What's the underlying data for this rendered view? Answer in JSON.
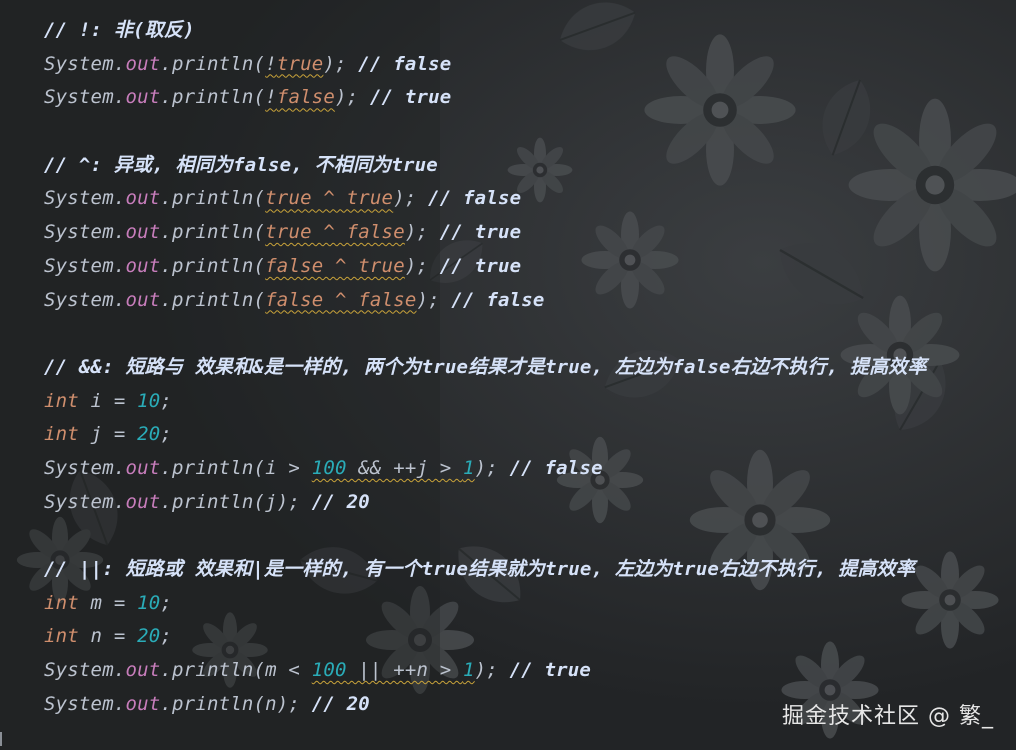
{
  "editor": {
    "lines": [
      [
        {
          "t": "// !: 非(取反)",
          "c": "comment"
        }
      ],
      [
        {
          "t": "System.",
          "c": "plain"
        },
        {
          "t": "out",
          "c": "field"
        },
        {
          "t": ".println(",
          "c": "plain"
        },
        {
          "t": "!",
          "c": "plain squiggle"
        },
        {
          "t": "true",
          "c": "kw squiggle"
        },
        {
          "t": "); ",
          "c": "plain"
        },
        {
          "t": "// false",
          "c": "comment"
        }
      ],
      [
        {
          "t": "System.",
          "c": "plain"
        },
        {
          "t": "out",
          "c": "field"
        },
        {
          "t": ".println(",
          "c": "plain"
        },
        {
          "t": "!",
          "c": "plain squiggle"
        },
        {
          "t": "false",
          "c": "kw squiggle"
        },
        {
          "t": "); ",
          "c": "plain"
        },
        {
          "t": "// true",
          "c": "comment"
        }
      ],
      [],
      [
        {
          "t": "// ^: 异或, 相同为false, 不相同为true",
          "c": "comment"
        }
      ],
      [
        {
          "t": "System.",
          "c": "plain"
        },
        {
          "t": "out",
          "c": "field"
        },
        {
          "t": ".println(",
          "c": "plain"
        },
        {
          "t": "true ^ true",
          "c": "kw squiggle"
        },
        {
          "t": "); ",
          "c": "plain"
        },
        {
          "t": "// false",
          "c": "comment"
        }
      ],
      [
        {
          "t": "System.",
          "c": "plain"
        },
        {
          "t": "out",
          "c": "field"
        },
        {
          "t": ".println(",
          "c": "plain"
        },
        {
          "t": "true ^ false",
          "c": "kw squiggle"
        },
        {
          "t": "); ",
          "c": "plain"
        },
        {
          "t": "// true",
          "c": "comment"
        }
      ],
      [
        {
          "t": "System.",
          "c": "plain"
        },
        {
          "t": "out",
          "c": "field"
        },
        {
          "t": ".println(",
          "c": "plain"
        },
        {
          "t": "false ^ true",
          "c": "kw squiggle"
        },
        {
          "t": "); ",
          "c": "plain"
        },
        {
          "t": "// true",
          "c": "comment"
        }
      ],
      [
        {
          "t": "System.",
          "c": "plain"
        },
        {
          "t": "out",
          "c": "field"
        },
        {
          "t": ".println(",
          "c": "plain"
        },
        {
          "t": "false ^ false",
          "c": "kw squiggle"
        },
        {
          "t": "); ",
          "c": "plain"
        },
        {
          "t": "// false",
          "c": "comment"
        }
      ],
      [],
      [
        {
          "t": "// &&: 短路与 效果和&是一样的, 两个为true结果才是true, 左边为false右边不执行, 提高效率",
          "c": "comment"
        }
      ],
      [
        {
          "t": "int",
          "c": "kw"
        },
        {
          "t": " i = ",
          "c": "plain"
        },
        {
          "t": "10",
          "c": "num"
        },
        {
          "t": ";",
          "c": "plain"
        }
      ],
      [
        {
          "t": "int",
          "c": "kw"
        },
        {
          "t": " j = ",
          "c": "plain"
        },
        {
          "t": "20",
          "c": "num"
        },
        {
          "t": ";",
          "c": "plain"
        }
      ],
      [
        {
          "t": "System.",
          "c": "plain"
        },
        {
          "t": "out",
          "c": "field"
        },
        {
          "t": ".println(i > ",
          "c": "plain"
        },
        {
          "t": "100",
          "c": "num squiggle"
        },
        {
          "t": " && ++j > ",
          "c": "plain squiggle"
        },
        {
          "t": "1",
          "c": "num squiggle"
        },
        {
          "t": "); ",
          "c": "plain"
        },
        {
          "t": "// false",
          "c": "comment"
        }
      ],
      [
        {
          "t": "System.",
          "c": "plain"
        },
        {
          "t": "out",
          "c": "field"
        },
        {
          "t": ".println(j); ",
          "c": "plain"
        },
        {
          "t": "// 20",
          "c": "comment"
        }
      ],
      [],
      [
        {
          "t": "// ||: 短路或 效果和|是一样的, 有一个true结果就为true, 左边为true右边不执行, 提高效率",
          "c": "comment"
        }
      ],
      [
        {
          "t": "int",
          "c": "kw"
        },
        {
          "t": " m = ",
          "c": "plain"
        },
        {
          "t": "10",
          "c": "num"
        },
        {
          "t": ";",
          "c": "plain"
        }
      ],
      [
        {
          "t": "int",
          "c": "kw"
        },
        {
          "t": " n = ",
          "c": "plain"
        },
        {
          "t": "20",
          "c": "num"
        },
        {
          "t": ";",
          "c": "plain"
        }
      ],
      [
        {
          "t": "System.",
          "c": "plain"
        },
        {
          "t": "out",
          "c": "field"
        },
        {
          "t": ".println(m < ",
          "c": "plain"
        },
        {
          "t": "100",
          "c": "num squiggle"
        },
        {
          "t": " || ++n > ",
          "c": "plain squiggle"
        },
        {
          "t": "1",
          "c": "num squiggle"
        },
        {
          "t": "); ",
          "c": "plain"
        },
        {
          "t": "// true",
          "c": "comment"
        }
      ],
      [
        {
          "t": "System.",
          "c": "plain"
        },
        {
          "t": "out",
          "c": "field"
        },
        {
          "t": ".println(n); ",
          "c": "plain"
        },
        {
          "t": "// 20",
          "c": "comment"
        }
      ]
    ]
  },
  "watermark": {
    "text": "掘金技术社区 @ 繁_"
  },
  "colors": {
    "background": "#232527",
    "comment": "#d6e2f8",
    "keyword": "#cf8e6d",
    "number": "#2aacb8",
    "field": "#c77dbb",
    "plain": "#bcc3cf",
    "squiggle": "#c9a33a"
  }
}
